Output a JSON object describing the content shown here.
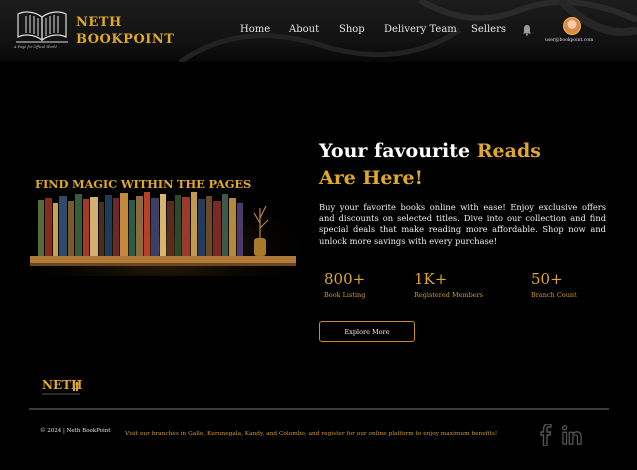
{
  "brand": {
    "line1": "NETH",
    "line2": "BOOKPOINT",
    "tagline": "A Page for Offical World"
  },
  "nav": {
    "items": [
      "Home",
      "About",
      "Shop",
      "Delivery Team",
      "Sellers"
    ]
  },
  "user": {
    "email": "user@bookpoint.com"
  },
  "banner": {
    "title": "FIND MAGIC WITHIN THE PAGES"
  },
  "hero": {
    "title_white": "Your favourite",
    "title_gold_1": "Reads",
    "title_gold_2": "Are Here!",
    "description": "Buy your favorite books online with ease! Enjoy exclusive offers and discounts on selected titles. Dive into our collection and find special deals that make reading more affordable. Shop now and unlock more savings with every purchase!"
  },
  "stats": [
    {
      "value": "800+",
      "label": "Book Listing"
    },
    {
      "value": "1K+",
      "label": "Registered Members"
    },
    {
      "value": "50+",
      "label": "Branch Count"
    }
  ],
  "cta": {
    "label": "Explore More"
  },
  "footer": {
    "copyright": "© 2024 | Neth BookPoint",
    "message": "Visit our branches in Galle, Kurunegala, Kandy, and Colombo, and register for our online platform to enjoy maximum benefits!"
  },
  "icons": {
    "bell": "bell-icon",
    "facebook": "facebook-icon",
    "linkedin": "linkedin-icon"
  },
  "colors": {
    "accent": "#e0a82a",
    "background": "#000000"
  }
}
